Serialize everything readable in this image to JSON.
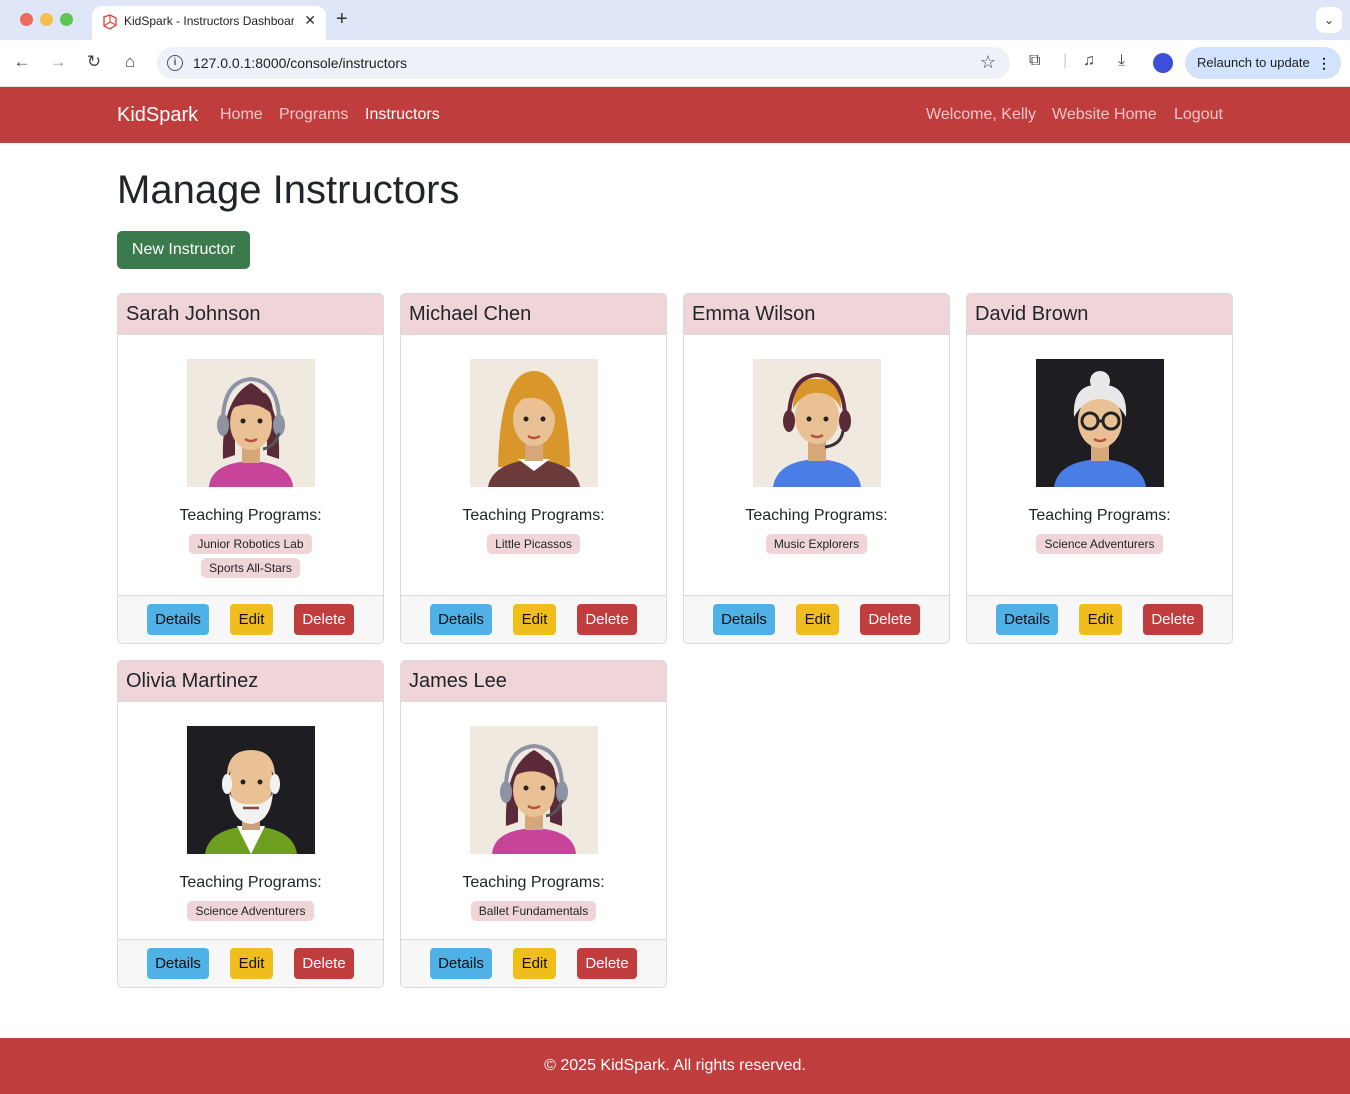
{
  "browser": {
    "tab_title": "KidSpark - Instructors Dashboard",
    "url": "127.0.0.1:8000/console/instructors",
    "relaunch_label": "Relaunch to update"
  },
  "navbar": {
    "brand": "KidSpark",
    "links": [
      "Home",
      "Programs",
      "Instructors"
    ],
    "active": "Instructors",
    "welcome": "Welcome, Kelly",
    "website_home": "Website Home",
    "logout": "Logout"
  },
  "page": {
    "title": "Manage Instructors",
    "new_button": "New Instructor",
    "teaching_label": "Teaching Programs:",
    "details_label": "Details",
    "edit_label": "Edit",
    "delete_label": "Delete"
  },
  "instructors": [
    {
      "name": "Sarah Johnson",
      "programs": [
        "Junior Robotics Lab",
        "Sports All-Stars"
      ],
      "avatar": "woman-headset-avatar"
    },
    {
      "name": "Michael Chen",
      "programs": [
        "Little Picassos"
      ],
      "avatar": "blonde-woman-avatar"
    },
    {
      "name": "Emma Wilson",
      "programs": [
        "Music Explorers"
      ],
      "avatar": "man-headset-avatar"
    },
    {
      "name": "David Brown",
      "programs": [
        "Science Adventurers"
      ],
      "avatar": "elder-woman-glasses-avatar"
    },
    {
      "name": "Olivia Martinez",
      "programs": [
        "Science Adventurers"
      ],
      "avatar": "bearded-elder-avatar"
    },
    {
      "name": "James Lee",
      "programs": [
        "Ballet Fundamentals"
      ],
      "avatar": "woman-headset-avatar"
    }
  ],
  "footer": {
    "text": "© 2025 KidSpark. All rights reserved."
  },
  "colors": {
    "brand": "#c03d3d",
    "card_header": "#f0d5d8",
    "success": "#3a7a4c",
    "info": "#4fb1e6",
    "warning": "#efbe1d"
  }
}
